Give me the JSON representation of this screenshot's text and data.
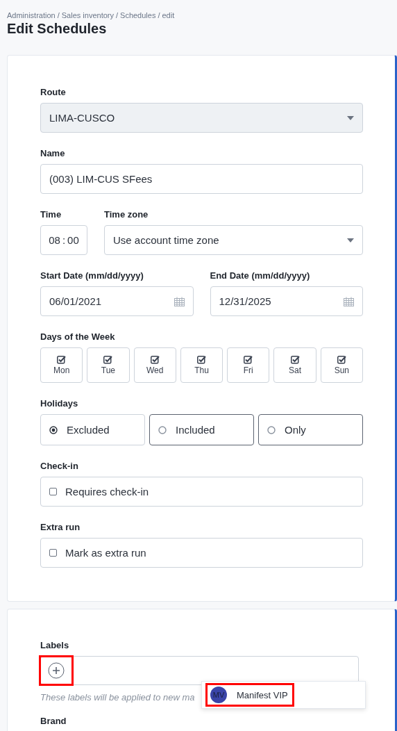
{
  "breadcrumb": [
    {
      "label": "Administration"
    },
    {
      "separator": "/",
      "label": "Sales inventory"
    },
    {
      "separator": "/",
      "label": "Schedules"
    },
    {
      "separator": "/",
      "label": "edit"
    }
  ],
  "title": "Edit Schedules",
  "route": {
    "label": "Route",
    "value": "LIMA-CUSCO",
    "disabled": true
  },
  "name": {
    "label": "Name",
    "value": "(003) LIM-CUS SFees"
  },
  "time": {
    "label": "Time",
    "hours": "08",
    "separator": ":",
    "minutes": "00"
  },
  "time_zone": {
    "label": "Time zone",
    "value": "Use account time zone"
  },
  "start_date": {
    "label": "Start Date (mm/dd/yyyy)",
    "value": "06/01/2021"
  },
  "end_date": {
    "label": "End Date (mm/dd/yyyy)",
    "value": "12/31/2025"
  },
  "days_of_week": {
    "label": "Days of the Week",
    "days": [
      {
        "label": "Mon",
        "checked": true
      },
      {
        "label": "Tue",
        "checked": true
      },
      {
        "label": "Wed",
        "checked": true
      },
      {
        "label": "Thu",
        "checked": true
      },
      {
        "label": "Fri",
        "checked": true
      },
      {
        "label": "Sat",
        "checked": true
      },
      {
        "label": "Sun",
        "checked": true
      }
    ]
  },
  "holidays": {
    "label": "Holidays",
    "options": [
      {
        "label": "Excluded",
        "selected": true
      },
      {
        "label": "Included",
        "selected": false
      },
      {
        "label": "Only",
        "selected": false
      }
    ]
  },
  "check_in": {
    "label": "Check-in",
    "option": "Requires check-in",
    "checked": false
  },
  "extra_run": {
    "label": "Extra run",
    "option": "Mark as extra run",
    "checked": false
  },
  "labels": {
    "label": "Labels",
    "add_highlighted": true,
    "help": "These labels will be applied to new ma",
    "dropdown": [
      {
        "initials": "MV",
        "name": "Manifest VIP",
        "highlighted": true
      }
    ]
  },
  "brand": {
    "label": "Brand"
  }
}
